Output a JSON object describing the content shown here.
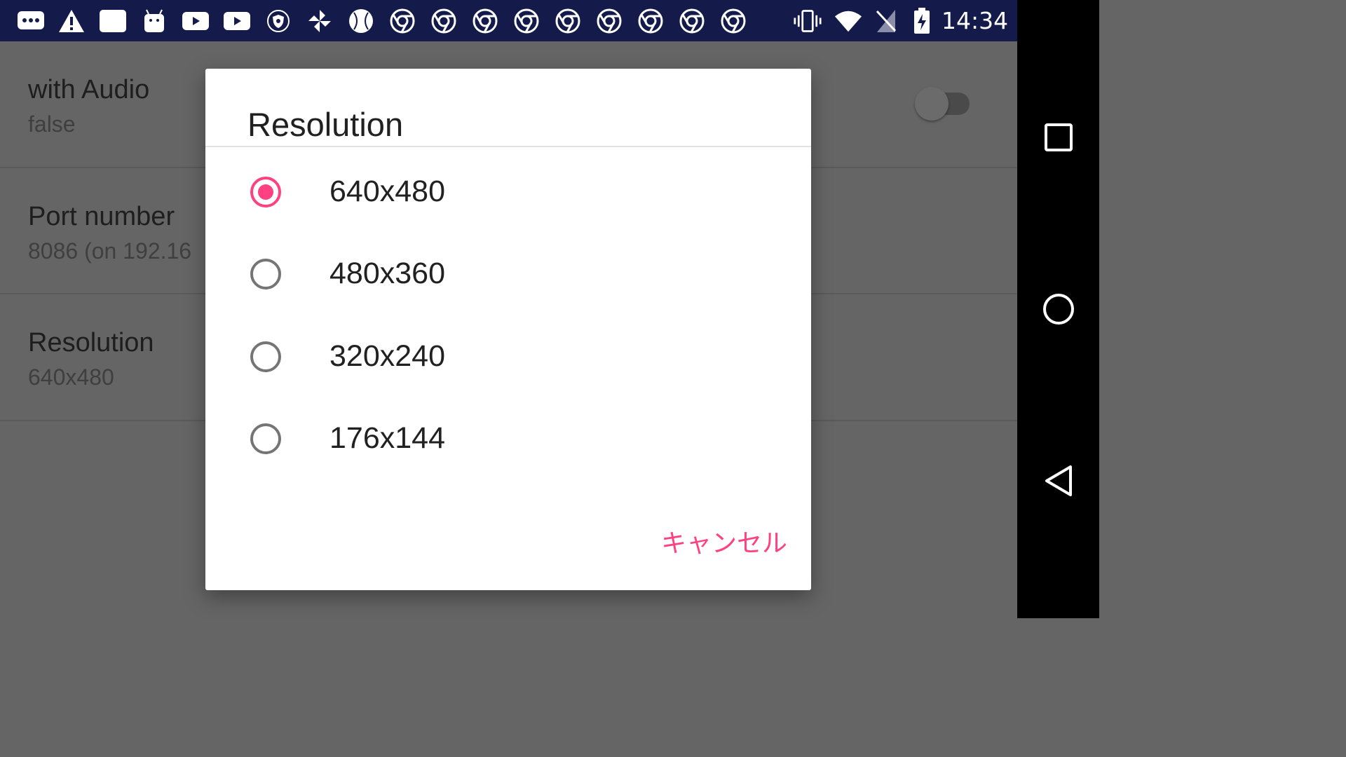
{
  "status_bar": {
    "time": "14:34",
    "notification_icons": [
      "more-chat-icon",
      "warning-icon",
      "window-icon",
      "android-debug-icon",
      "youtube-icon",
      "youtube-icon",
      "vpn-shield-icon",
      "pinwheel-icon",
      "baseball-icon",
      "chrome-icon",
      "chrome-icon",
      "chrome-icon",
      "chrome-icon",
      "chrome-icon",
      "chrome-icon",
      "chrome-icon",
      "chrome-icon",
      "chrome-icon"
    ],
    "system_icons": [
      "vibrate-icon",
      "wifi-icon",
      "no-sim-icon",
      "battery-charging-icon"
    ]
  },
  "settings": {
    "items": [
      {
        "title": "with Audio",
        "summary": "false",
        "has_toggle": true,
        "toggle_on": false
      },
      {
        "title": "Port number",
        "summary": "8086 (on 192.16"
      },
      {
        "title": "Resolution",
        "summary": "640x480"
      }
    ]
  },
  "dialog": {
    "title": "Resolution",
    "options": [
      {
        "label": "640x480",
        "selected": true
      },
      {
        "label": "480x360",
        "selected": false
      },
      {
        "label": "320x240",
        "selected": false
      },
      {
        "label": "176x144",
        "selected": false
      }
    ],
    "cancel_label": "キャンセル"
  },
  "navigation": {
    "buttons": [
      "recents-icon",
      "home-icon",
      "back-icon"
    ]
  },
  "colors": {
    "status_bar": "#141a4a",
    "accent": "#ff4081",
    "scrim_background": "#656565",
    "nav_bar": "#000000"
  }
}
